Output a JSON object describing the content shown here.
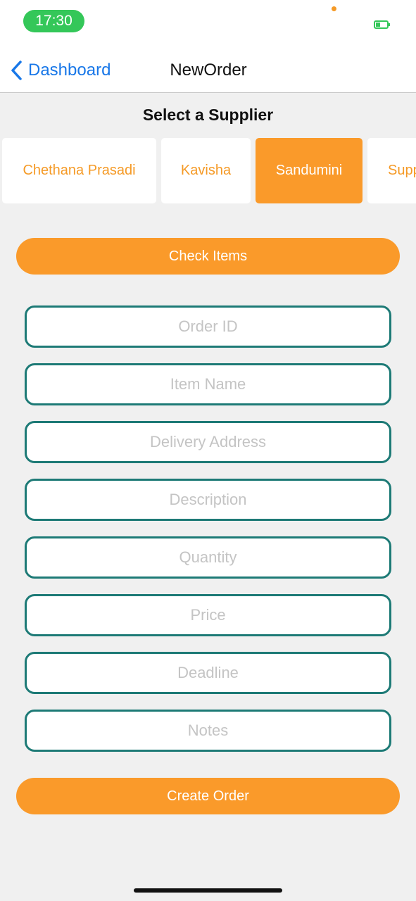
{
  "status_bar": {
    "time": "17:30"
  },
  "nav": {
    "back_label": "Dashboard",
    "title": "NewOrder"
  },
  "supplier_section": {
    "title": "Select a Supplier",
    "suppliers": [
      {
        "label": "Chethana Prasadi",
        "selected": false
      },
      {
        "label": "Kavisha",
        "selected": false
      },
      {
        "label": "Sandumini",
        "selected": true
      },
      {
        "label": "Supp",
        "selected": false
      }
    ]
  },
  "actions": {
    "check_items": "Check Items",
    "create_order": "Create Order"
  },
  "form": {
    "fields": [
      {
        "placeholder": "Order ID",
        "value": ""
      },
      {
        "placeholder": "Item Name",
        "value": ""
      },
      {
        "placeholder": "Delivery Address",
        "value": ""
      },
      {
        "placeholder": "Description",
        "value": ""
      },
      {
        "placeholder": "Quantity",
        "value": ""
      },
      {
        "placeholder": "Price",
        "value": ""
      },
      {
        "placeholder": "Deadline",
        "value": ""
      },
      {
        "placeholder": "Notes",
        "value": ""
      }
    ]
  },
  "colors": {
    "accent": "#fa9a2a",
    "field_border": "#1d7a76",
    "link": "#1877e8",
    "status_green": "#34c759"
  }
}
